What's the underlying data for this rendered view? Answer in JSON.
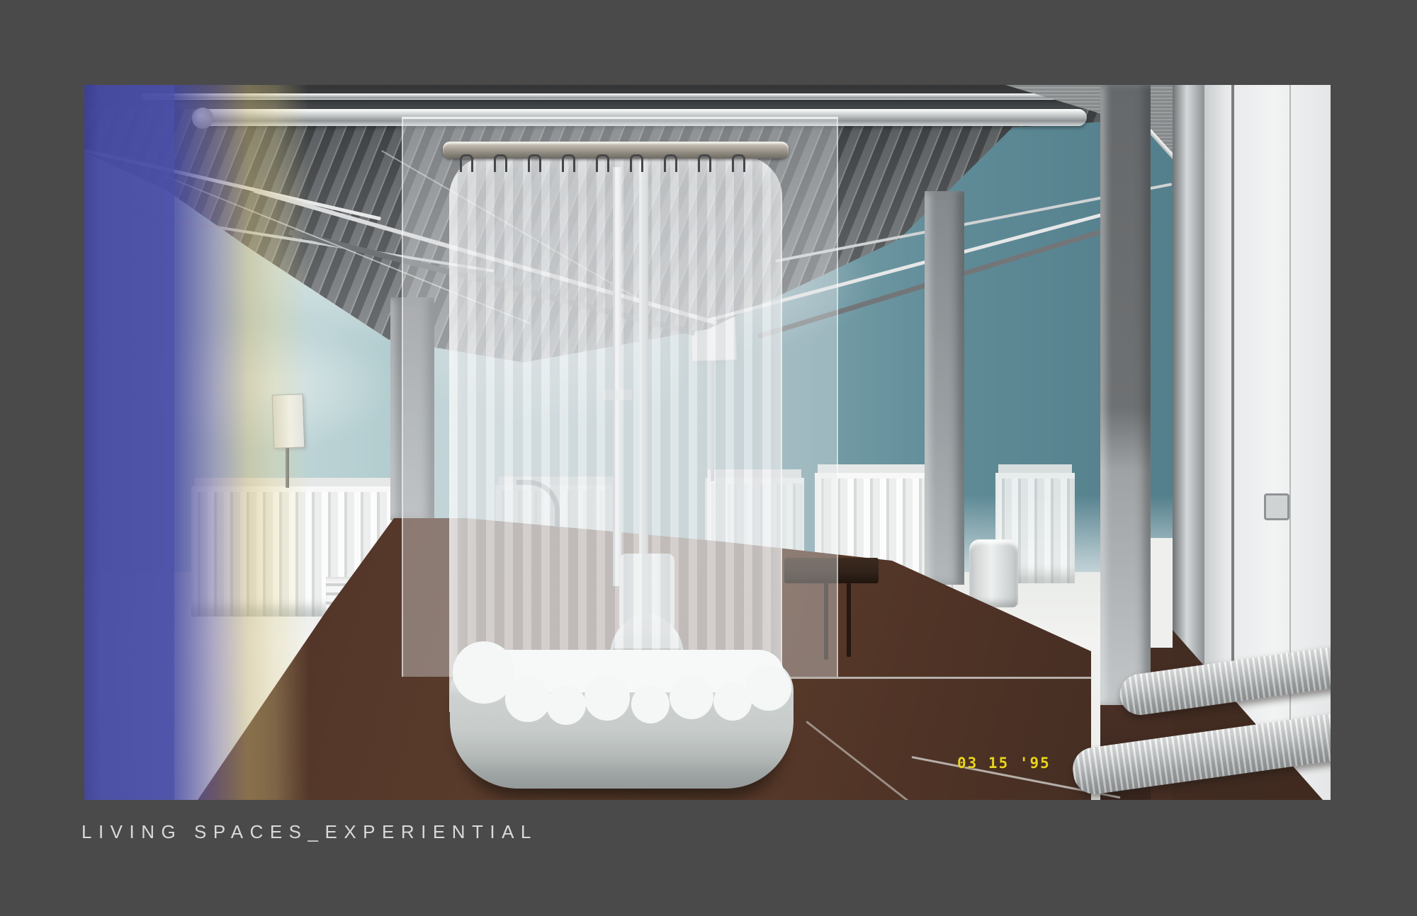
{
  "slide": {
    "caption": "LIVING SPACES_EXPERIENTIAL"
  },
  "artwork": {
    "timestamp": "03 15 '95"
  },
  "colors": {
    "background": "#4a4a4b",
    "caption_text": "#d9d9d9",
    "blue_strip": "#474ba3",
    "fade_yellow": "#e3d08a",
    "sky_left": "#c6dadb",
    "sky_right": "#54808d",
    "ground": "#f2f3f1",
    "floor_brown": "#4f3326",
    "floor_brown_dark": "#3a2820",
    "ceiling_metal": "#6a6d6f",
    "metal_highlight": "#e9eaea",
    "column_gray": "#8d9296",
    "column_light": "#c3c7c9",
    "door_white": "#e4e6e7",
    "curtain_white": "#eef0f1",
    "tub_gray": "#c7cccb",
    "table_brown": "#31221a",
    "seam_white": "#d9d9d6",
    "timestamp_yellow": "#e9d41d"
  }
}
